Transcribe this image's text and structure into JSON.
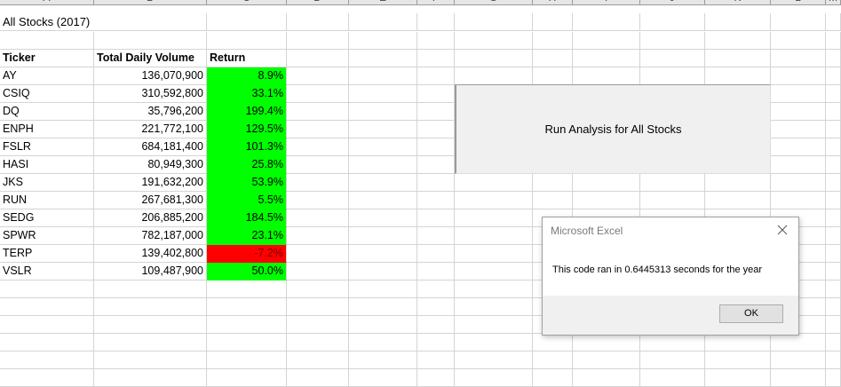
{
  "spreadsheet": {
    "column_headers": [
      "A",
      "B",
      "C",
      "D",
      "E",
      "F",
      "G",
      "H",
      "I",
      "J",
      "K",
      "L",
      "M"
    ],
    "title": "All Stocks (2017)",
    "table_headers": {
      "ticker": "Ticker",
      "volume": "Total Daily Volume",
      "return": "Return"
    },
    "rows": [
      {
        "ticker": "AY",
        "volume": "136,070,900",
        "return": "8.9%",
        "status": "positive"
      },
      {
        "ticker": "CSIQ",
        "volume": "310,592,800",
        "return": "33.1%",
        "status": "positive"
      },
      {
        "ticker": "DQ",
        "volume": "35,796,200",
        "return": "199.4%",
        "status": "positive"
      },
      {
        "ticker": "ENPH",
        "volume": "221,772,100",
        "return": "129.5%",
        "status": "positive"
      },
      {
        "ticker": "FSLR",
        "volume": "684,181,400",
        "return": "101.3%",
        "status": "positive"
      },
      {
        "ticker": "HASI",
        "volume": "80,949,300",
        "return": "25.8%",
        "status": "positive"
      },
      {
        "ticker": "JKS",
        "volume": "191,632,200",
        "return": "53.9%",
        "status": "positive"
      },
      {
        "ticker": "RUN",
        "volume": "267,681,300",
        "return": "5.5%",
        "status": "positive"
      },
      {
        "ticker": "SEDG",
        "volume": "206,885,200",
        "return": "184.5%",
        "status": "positive"
      },
      {
        "ticker": "SPWR",
        "volume": "782,187,000",
        "return": "23.1%",
        "status": "positive"
      },
      {
        "ticker": "TERP",
        "volume": "139,402,800",
        "return": "-7.2%",
        "status": "negative"
      },
      {
        "ticker": "VSLR",
        "volume": "109,487,900",
        "return": "50.0%",
        "status": "positive"
      }
    ],
    "colors": {
      "positive": "#00ff00",
      "negative": "#ff0000"
    }
  },
  "run_button": {
    "label": "Run Analysis for All Stocks"
  },
  "dialog": {
    "title": "Microsoft Excel",
    "message": "This code ran in 0.6445313 seconds for the year",
    "ok_label": "OK",
    "close_icon": "close-icon"
  }
}
